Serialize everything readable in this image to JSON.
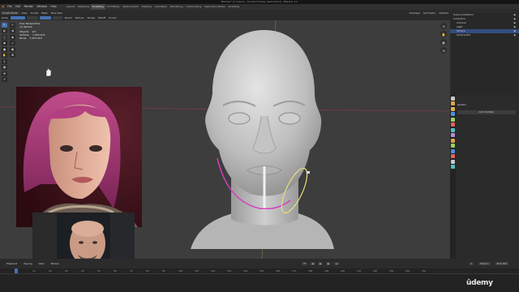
{
  "window": {
    "title": "Blender* [C:\\Users\\...\\Sculpt_Female_head.blend] - Blender 4.2"
  },
  "menubar": {
    "items": [
      "File",
      "Edit",
      "Render",
      "Window",
      "Help"
    ],
    "workspaces": [
      "Layout",
      "Modeling",
      "Sculpting",
      "UV Editing",
      "Texture Paint",
      "Shading",
      "Animation",
      "Rendering",
      "Compositing",
      "Geometry Nodes",
      "Scripting"
    ],
    "active_workspace": "Sculpting"
  },
  "header": {
    "mode": "Sculpt Mode",
    "items": [
      "View",
      "Sculpt",
      "Mask",
      "Face Sets"
    ],
    "brush_label": "Draw",
    "tool_options": [
      "Brush",
      "Texture",
      "Stroke",
      "Falloff",
      "Cursor"
    ],
    "right_items": [
      "Overlays",
      "Symmetry",
      "Options"
    ]
  },
  "viewport": {
    "view_name": "User Perspective",
    "object_name": "(1) Sphere",
    "stats": [
      [
        "Objects",
        "1/2"
      ],
      [
        "Vertices",
        "7,423,419"
      ],
      [
        "Faces",
        "7,423,419"
      ]
    ]
  },
  "outliner": {
    "header": "Scene Collection",
    "rows": [
      {
        "label": "Collection",
        "selected": false
      },
      {
        "label": "Camera",
        "selected": false
      },
      {
        "label": "Light",
        "selected": false
      },
      {
        "label": "Sphere",
        "selected": true
      },
      {
        "label": "Sphere.001",
        "selected": false
      }
    ]
  },
  "properties": {
    "header": "Sphere",
    "button": "Add Modifier",
    "tab_colors": [
      "#c8c8c8",
      "#e0a050",
      "#d9b04a",
      "#4c90e0",
      "#9ad15a",
      "#e36060",
      "#4ec2c2",
      "#b48ad6",
      "#e0a050",
      "#9ad15a",
      "#4c90e0",
      "#e36060",
      "#c8c8c8",
      "#4ec2c2"
    ]
  },
  "timeline": {
    "items": [
      "Playback",
      "Keying",
      "View",
      "Marker"
    ],
    "frame_current": "1",
    "start_label": "Start",
    "start": "1",
    "end_label": "End",
    "end": "250",
    "ruler": [
      "0",
      "10",
      "20",
      "30",
      "40",
      "50",
      "60",
      "70",
      "80",
      "90",
      "100",
      "110",
      "120",
      "130",
      "140",
      "150",
      "160",
      "170",
      "180",
      "190",
      "200",
      "210",
      "220",
      "230",
      "240",
      "250"
    ]
  },
  "watermark": {
    "brand": "ûdemy"
  },
  "icons": {
    "tools": [
      "draw-icon",
      "clay-icon",
      "smooth-icon",
      "crease-icon",
      "inflate-icon",
      "grab-icon",
      "snake-hook-icon",
      "mask-icon",
      "transform-icon",
      "annotate-icon"
    ],
    "nav": [
      "zoom-icon",
      "hand-icon",
      "camera-icon",
      "grid-icon"
    ]
  }
}
